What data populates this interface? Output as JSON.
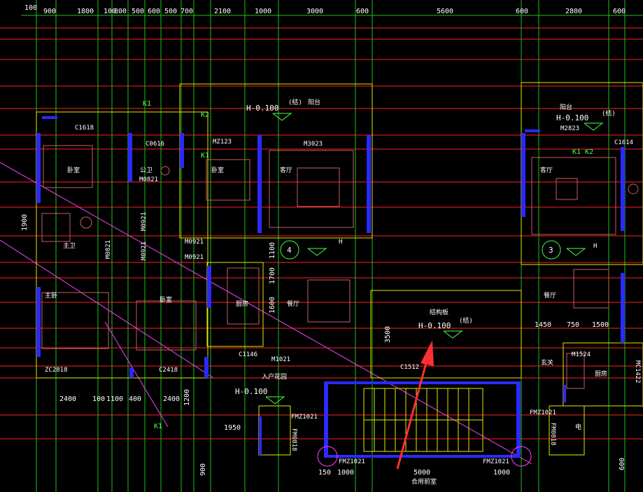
{
  "colors": {
    "background": "#000000",
    "grid_red": "#ff2020",
    "grid_green": "#18c418",
    "wall_blue": "#2a2aff",
    "outline_yellow": "#e8e800",
    "furniture": "#c86060",
    "magenta": "#ff40ff",
    "annotation_arrow": "#ff3030"
  },
  "top_dimensions": [
    "100",
    "900",
    "1800",
    "100",
    "800",
    "500",
    "600",
    "500",
    "700",
    "2100",
    "1000",
    "3000",
    "600",
    "5600",
    "600",
    "2800",
    "600"
  ],
  "left_dimensions": [
    "100",
    "1900",
    "900"
  ],
  "rooms": {
    "bedroom_1": "卧室",
    "bedroom_2": "卧室",
    "bedroom_3": "卧室",
    "master_bedroom": "主卧",
    "master_bath": "主卫",
    "public_bath": "公卫",
    "living_left": "客厅",
    "living_right": "客厅",
    "kitchen_left": "厨房",
    "kitchen_right": "厨房",
    "dining_left": "餐厅",
    "dining_right": "餐厅",
    "balcony_left": "阳台",
    "balcony_right": "阳台",
    "structural_slab": "结构板",
    "entrance": "玄关",
    "entry_garden": "入户花园",
    "shared_front_room": "合用前室",
    "elevator": "电"
  },
  "elevations": {
    "balcony_left": "H-0.100",
    "balcony_right": "H-0.100",
    "structural": "H-0.100",
    "entry_garden": "H-0.100",
    "living_left": "H",
    "living_right": "H",
    "struct_mark": "(结)"
  },
  "axis_markers": [
    "4",
    "3"
  ],
  "windows": {
    "c1618": "C1618",
    "c0616": "C0616",
    "c1614": "C1614",
    "mz123": "MZ123",
    "m3023": "M3023",
    "m2823": "M2823",
    "m0821": "M0821",
    "m0921_a": "M0921",
    "m0921_b": "M0921",
    "m0921_c": "M0921",
    "m0921_d": "M0921",
    "m0821_v": "M0821",
    "m1021": "M1021",
    "c1146": "C1146",
    "c1512": "C1512",
    "m1524": "M1524",
    "zc2818": "ZC2818",
    "c2418": "C2418",
    "fmz1021_a": "FMZ1021",
    "fmz1021_b": "FMZ1021",
    "fmz1021_c": "FMZ1021",
    "fmz1021_d": "FMZ1021",
    "fm0818_a": "FM0818",
    "fm0818_b": "FM0818",
    "mc1422": "MC1422"
  },
  "tags": {
    "k1_a": "K1",
    "k1_b": "K1",
    "k1_c": "K1",
    "k2_a": "K2",
    "k1k2": "K1 K2"
  },
  "inner_dimensions": {
    "d1100": "1100",
    "d1700": "1700",
    "d1600": "1600",
    "d3500": "3500",
    "d1450": "1450",
    "d750": "750",
    "d1500": "1500",
    "d1950": "1950",
    "d1200": "1200",
    "d900b": "900"
  },
  "bottom_dimensions": [
    "2400",
    "100",
    "1100",
    "400",
    "2400",
    "150",
    "1000",
    "5000",
    "1000",
    "600"
  ]
}
